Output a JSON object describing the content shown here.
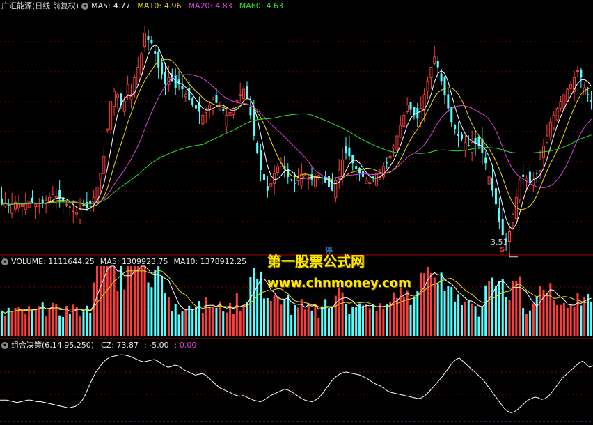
{
  "price_header": {
    "title": "广汇能源(日线 前复权)",
    "ma5_label": "MA5:",
    "ma5_value": "4.77",
    "ma10_label": "MA10:",
    "ma10_value": "4.96",
    "ma20_label": "MA20:",
    "ma20_value": "4.83",
    "ma60_label": "MA60:",
    "ma60_value": "4.63"
  },
  "volume_header": {
    "title": "VOLUME: 1111644.25",
    "ma5": "MA5: 1309923.75",
    "ma10": "MA10: 1378912.25"
  },
  "indicator_header": {
    "title": "组合决策(6,14,95,250)",
    "cz": "CZ: 73.87",
    "v1": ": -5.00",
    "v2": ": 0.00"
  },
  "annotations": {
    "low_label": "3.51",
    "suspend_mark": "停",
    "s_mark": "S"
  },
  "watermark": {
    "line1": "第一股票公式网",
    "line2": "www.chnmoney.com"
  },
  "colors": {
    "up": "#ff3c3c",
    "down": "#54ffff",
    "ma5": "#ffffff",
    "ma10": "#f0e000",
    "ma20": "#e040e0",
    "ma60": "#30e030",
    "grid": "#8b0000"
  },
  "chart_data": [
    {
      "type": "candlestick",
      "series": [
        {
          "name": "MA5",
          "last": 4.77
        },
        {
          "name": "MA10",
          "last": 4.96
        },
        {
          "name": "MA20",
          "last": 4.83
        },
        {
          "name": "MA60",
          "last": 4.63
        }
      ],
      "ylim": [
        3.4,
        6.9
      ],
      "annotations": [
        {
          "text": "3.51",
          "note": "period low"
        }
      ],
      "closes": [
        4.1,
        4.12,
        4.08,
        4.1,
        4.13,
        4.11,
        4.09,
        4.12,
        4.15,
        4.13,
        4.1,
        4.08,
        4.12,
        4.16,
        4.2,
        4.24,
        4.21,
        4.18,
        4.14,
        4.1,
        4.06,
        4.0,
        3.98,
        4.02,
        4.08,
        4.04,
        4.1,
        4.2,
        4.35,
        4.55,
        4.8,
        5.2,
        5.6,
        5.75,
        5.7,
        5.55,
        5.6,
        5.85,
        5.7,
        5.95,
        6.1,
        6.3,
        6.6,
        6.5,
        6.45,
        6.3,
        6.1,
        6.0,
        5.85,
        5.95,
        5.9,
        5.8,
        5.85,
        5.78,
        5.7,
        5.62,
        5.55,
        5.5,
        5.45,
        5.4,
        5.48,
        5.55,
        5.62,
        5.58,
        5.52,
        5.46,
        5.4,
        5.44,
        5.5,
        5.62,
        5.7,
        5.78,
        5.65,
        5.4,
        5.1,
        4.85,
        4.6,
        4.45,
        4.3,
        4.4,
        4.55,
        4.65,
        4.7,
        4.62,
        4.5,
        4.45,
        4.4,
        4.48,
        4.55,
        4.52,
        4.48,
        4.46,
        4.5,
        4.52,
        4.48,
        4.42,
        4.35,
        4.3,
        4.45,
        4.6,
        4.75,
        4.85,
        4.8,
        4.7,
        4.62,
        4.55,
        4.5,
        4.45,
        4.42,
        4.48,
        4.55,
        4.6,
        4.65,
        4.7,
        4.8,
        4.95,
        5.1,
        5.25,
        5.4,
        5.55,
        5.48,
        5.4,
        5.35,
        5.5,
        5.7,
        5.9,
        6.1,
        6.25,
        6.1,
        5.9,
        5.7,
        5.5,
        5.3,
        5.2,
        5.1,
        5.05,
        5.0,
        4.95,
        5.0,
        4.98,
        4.95,
        4.85,
        4.7,
        4.5,
        4.3,
        4.1,
        3.85,
        3.65,
        3.55,
        3.7,
        3.95,
        4.2,
        4.45,
        4.5,
        4.48,
        4.42,
        4.45,
        4.55,
        4.75,
        4.95,
        5.1,
        5.3,
        5.4,
        5.5,
        5.6,
        5.7,
        5.78,
        5.85,
        5.95,
        6.05,
        5.95,
        5.8,
        5.7,
        5.6
      ]
    },
    {
      "type": "bar",
      "name": "VOLUME",
      "values": [
        1111644.25
      ],
      "series": [
        {
          "name": "MA5",
          "last": 1309923.75
        },
        {
          "name": "MA10",
          "last": 1378912.25
        }
      ]
    },
    {
      "type": "line",
      "name": "组合决策(6,14,95,250)",
      "series": [
        {
          "name": "CZ",
          "last": 73.87
        }
      ],
      "values": [
        30,
        30,
        30,
        29,
        28,
        27,
        28,
        29,
        30,
        30,
        29,
        28,
        28,
        27,
        26,
        25,
        24,
        23,
        22,
        21,
        20,
        21,
        22,
        25,
        30,
        38,
        48,
        58,
        66,
        72,
        78,
        82,
        85,
        86,
        87,
        88,
        88,
        87,
        86,
        84,
        82,
        80,
        79,
        80,
        81,
        82,
        80,
        77,
        74,
        72,
        73,
        75,
        74,
        71,
        68,
        66,
        64,
        62,
        63,
        64,
        62,
        58,
        54,
        50,
        46,
        44,
        42,
        40,
        38,
        36,
        35,
        36,
        34,
        32,
        30,
        29,
        28,
        30,
        33,
        36,
        38,
        40,
        42,
        44,
        43,
        41,
        38,
        35,
        32,
        30,
        29,
        28,
        30,
        33,
        38,
        44,
        50,
        56,
        60,
        63,
        65,
        66,
        65,
        64,
        63,
        62,
        60,
        58,
        55,
        52,
        50,
        48,
        45,
        42,
        40,
        39,
        38,
        37,
        36,
        35,
        34,
        33,
        32,
        33,
        36,
        40,
        45,
        50,
        55,
        60,
        66,
        72,
        78,
        82,
        84,
        80,
        76,
        72,
        68,
        64,
        60,
        56,
        50,
        44,
        38,
        32,
        26,
        20,
        16,
        14,
        15,
        18,
        22,
        26,
        30,
        32,
        34,
        33,
        31,
        32,
        35,
        40,
        46,
        52,
        58,
        62,
        66,
        70,
        74,
        78,
        80,
        76,
        72,
        74
      ]
    }
  ]
}
